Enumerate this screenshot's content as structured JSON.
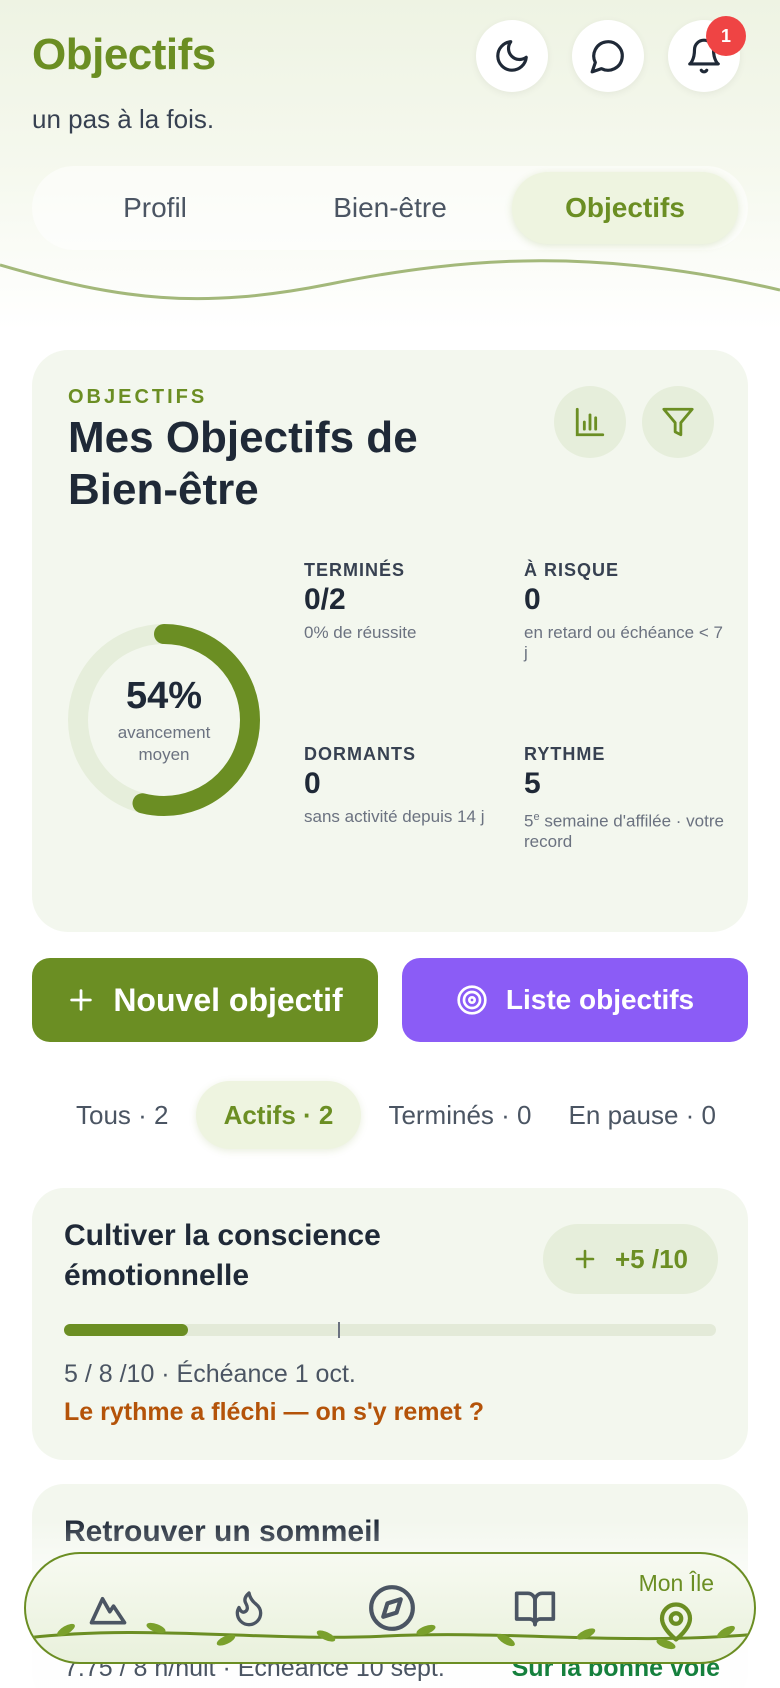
{
  "header": {
    "title": "Objectifs",
    "subtitle": "un pas à la fois.",
    "notification_count": "1",
    "accent_color": "#6b8e23"
  },
  "tabs": [
    {
      "label": "Profil",
      "active": false
    },
    {
      "label": "Bien-être",
      "active": false
    },
    {
      "label": "Objectifs",
      "active": true
    }
  ],
  "summary": {
    "eyebrow": "OBJECTIFS",
    "title": "Mes Objectifs de Bien-être",
    "progress_percent": 54,
    "progress_label": "54%",
    "progress_caption": "avancement moyen",
    "stats": {
      "done": {
        "label": "TERMINÉS",
        "value": "0/2",
        "desc": "0% de réussite"
      },
      "risk": {
        "label": "À RISQUE",
        "value": "0",
        "desc": "en retard ou échéance < 7 j"
      },
      "dormant": {
        "label": "DORMANTS",
        "value": "0",
        "desc": "sans activité depuis 14 j"
      },
      "rhythm": {
        "label": "RYTHME",
        "value": "5",
        "desc_num": "5",
        "desc_sup": "e",
        "desc_rest": " semaine d'affilée · votre record"
      }
    }
  },
  "actions": {
    "new_goal": "Nouvel objectif",
    "goal_list": "Liste objectifs",
    "new_goal_color": "#6b8e23",
    "goal_list_color": "#8b5cf6"
  },
  "filters": [
    {
      "label": "Tous · 2",
      "active": false
    },
    {
      "label": "Actifs · 2",
      "active": true
    },
    {
      "label": "Terminés · 0",
      "active": false
    },
    {
      "label": "En pause · 0",
      "active": false
    }
  ],
  "goals": [
    {
      "title": "Cultiver la conscience émotionnelle",
      "chip": "+5 /10",
      "progress": 0.19,
      "target_marker": 0.42,
      "meta": "5 / 8 /10 · Échéance 1 oct.",
      "warning": "Le rythme a fléchi — on s'y remet ?"
    },
    {
      "title": "Retrouver un sommeil",
      "meta": "7.75 / 8 h/nuit · Échéance 10 sept.",
      "status": "Sur la bonne voie"
    }
  ],
  "bottom_nav": {
    "active_label": "Mon Île",
    "items": [
      "mountain-icon",
      "flame-icon",
      "compass-icon",
      "book-icon",
      "map-pin-icon"
    ]
  }
}
